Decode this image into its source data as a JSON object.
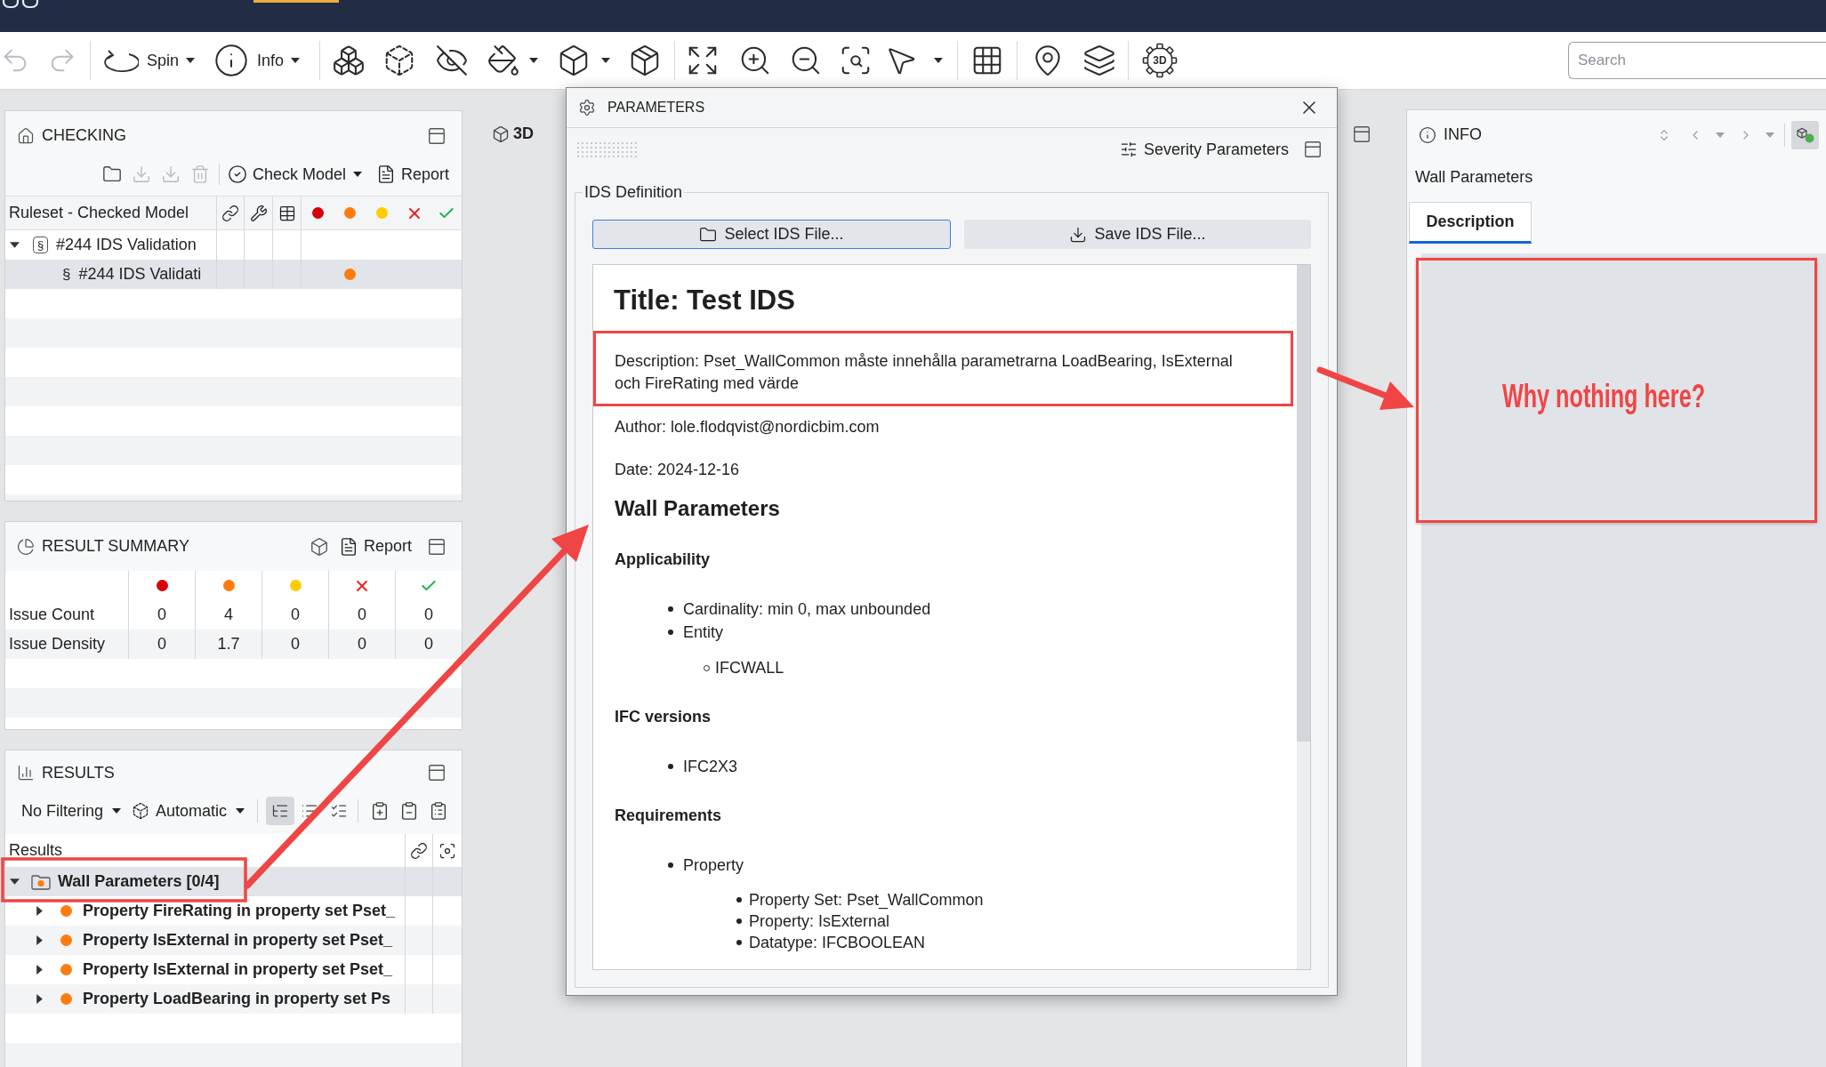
{
  "top_bar": {
    "tabs": [
      {
        "selected": true
      }
    ]
  },
  "toolbar": {
    "undo": {
      "disabled": true
    },
    "redo": {
      "disabled": true
    },
    "menus": [
      {
        "label": "Spin"
      },
      {
        "label": "Info"
      }
    ],
    "gear_label": "3D",
    "search": {
      "placeholder": "Search"
    }
  },
  "checking": {
    "title": "CHECKING",
    "file_actions": [
      {
        "disabled": false
      },
      {
        "disabled": true
      },
      {
        "disabled": true
      },
      {
        "disabled": true
      }
    ],
    "check_button": "Check Model",
    "report_button": "Report",
    "table": {
      "name_column": "Ruleset - Checked Model",
      "severity_columns": [
        {
          "kind": "dot",
          "color": "#d7000a"
        },
        {
          "kind": "dot",
          "color": "#ff7b0f"
        },
        {
          "kind": "dot",
          "color": "#ffcc00"
        },
        {
          "kind": "cross",
          "color": "#e52424"
        },
        {
          "kind": "check",
          "color": "#1fb34a"
        }
      ],
      "rows": [
        {
          "kind": "ruleset",
          "glyph": "§",
          "name": "#244 IDS Validation",
          "expanded": true,
          "selected": false,
          "children": [
            {
              "kind": "rule",
              "glyph": "§",
              "name": "#244 IDS Validati",
              "selected": true,
              "color": "#ff7b0f"
            }
          ]
        }
      ]
    }
  },
  "result_summary": {
    "title": "RESULT SUMMARY",
    "report_button": "Report",
    "severity_columns": [
      {
        "kind": "dot",
        "color": "#d7000a"
      },
      {
        "kind": "dot",
        "color": "#ff7b0f"
      },
      {
        "kind": "dot",
        "color": "#ffcc00"
      },
      {
        "kind": "cross",
        "color": "#e52424"
      },
      {
        "kind": "check",
        "color": "#1fb34a"
      }
    ],
    "rows": [
      {
        "label": "Issue Count",
        "values": [
          "0",
          "4",
          "0",
          "0",
          "0"
        ]
      },
      {
        "label": "Issue Density",
        "values": [
          "0",
          "1.7",
          "0",
          "0",
          "0"
        ]
      }
    ]
  },
  "results": {
    "title": "RESULTS",
    "filter": "No Filtering",
    "mode": "Automatic",
    "view_modes": [
      {
        "selected": true
      },
      {
        "selected": false
      },
      {
        "selected": false
      }
    ],
    "column_header": "Results",
    "tree": [
      {
        "kind": "group",
        "name": "Wall Parameters [0/4]",
        "color": "#ff7b0f",
        "expanded": true,
        "selected": true,
        "children": [
          {
            "kind": "issue",
            "name": "Property FireRating in property set Pset_",
            "color": "#ff7b0f",
            "expanded": false,
            "selected": false
          },
          {
            "kind": "issue",
            "name": "Property IsExternal in property set Pset_",
            "color": "#ff7b0f",
            "expanded": false,
            "selected": false
          },
          {
            "kind": "issue",
            "name": "Property IsExternal in property set Pset_",
            "color": "#ff7b0f",
            "expanded": false,
            "selected": false
          },
          {
            "kind": "issue",
            "name": "Property LoadBearing in property set Ps",
            "color": "#ff7b0f",
            "expanded": false,
            "selected": false
          }
        ]
      }
    ]
  },
  "viewport": {
    "tab": "3D"
  },
  "dialog": {
    "title": "PARAMETERS",
    "severity_button": "Severity Parameters",
    "group_label": "IDS Definition",
    "buttons": [
      {
        "label": "Select IDS File...",
        "focused": true
      },
      {
        "label": "Save IDS File...",
        "focused": false
      }
    ],
    "document": {
      "title": "Title: Test IDS",
      "description": "Description: Pset_WallCommon måste innehålla parametrarna LoadBearing, IsExternal och FireRating med värde",
      "author": "Author: lole.flodqvist@nordicbim.com",
      "date": "Date: 2024-12-16",
      "specification": "Wall Parameters",
      "sections": [
        {
          "heading": "Applicability",
          "items": [
            {
              "text": "Cardinality: min 0, max unbounded",
              "kind": "disc"
            },
            {
              "text": "Entity",
              "kind": "disc",
              "children": [
                {
                  "text": "IFCWALL",
                  "kind": "circle"
                }
              ]
            }
          ]
        },
        {
          "heading": "IFC versions",
          "items": [
            {
              "text": "IFC2X3",
              "kind": "disc"
            }
          ]
        },
        {
          "heading": "Requirements",
          "items": [
            {
              "text": "Property",
              "kind": "disc",
              "children": [
                {
                  "text": "Property Set: Pset_WallCommon",
                  "kind": "disc"
                },
                {
                  "text": "Property: IsExternal",
                  "kind": "disc"
                },
                {
                  "text": "Datatype: IFCBOOLEAN",
                  "kind": "disc"
                }
              ]
            }
          ]
        }
      ]
    }
  },
  "info": {
    "title": "INFO",
    "subject": "Wall Parameters",
    "view_toggle": {
      "on": true
    },
    "tabs": [
      {
        "label": "Description",
        "selected": true
      }
    ],
    "annotation_note": "Why nothing here?"
  }
}
